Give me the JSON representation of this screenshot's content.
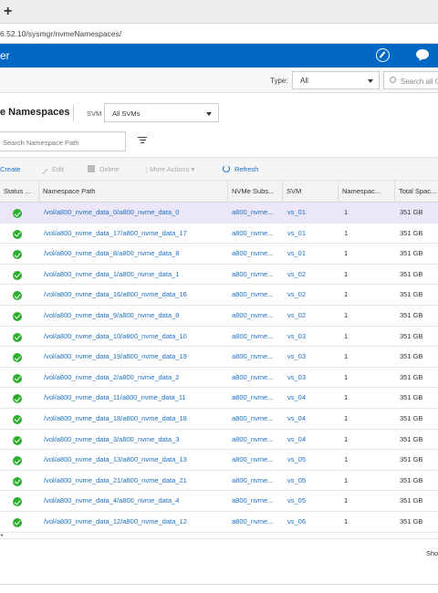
{
  "browser": {
    "tab_close": "×",
    "new_tab": "+",
    "address": "6.52.10/sysmgr/nvmeNamespaces/"
  },
  "app": {
    "title": "er"
  },
  "filter": {
    "type_label": "Type:",
    "type_value": "All",
    "search_placeholder": "Search all O"
  },
  "page": {
    "title": "e Namespaces",
    "svm_label": "SVM",
    "svm_value": "All SVMs",
    "search_placeholder": "Search Namespace Path"
  },
  "toolbar": {
    "create": "Create",
    "edit": "Edit",
    "delete": "Delete",
    "more_actions": "More Actions",
    "refresh": "Refresh"
  },
  "table": {
    "columns": [
      "Status ...",
      "Namespace Path",
      "NVMe Subs...",
      "SVM",
      "Namespac...",
      "Total Spac..."
    ],
    "rows": [
      {
        "path": "/vol/a800_nvme_data_0/a800_nvme_data_0",
        "subsystem": "a800_nvme...",
        "svm": "vs_01",
        "ns": "1",
        "total": "351 GB"
      },
      {
        "path": "/vol/a800_nvme_data_17/a800_nvme_data_17",
        "subsystem": "a800_nvme...",
        "svm": "vs_01",
        "ns": "1",
        "total": "351 GB"
      },
      {
        "path": "/vol/a800_nvme_data_8/a800_nvme_data_8",
        "subsystem": "a800_nvme...",
        "svm": "vs_01",
        "ns": "1",
        "total": "351 GB"
      },
      {
        "path": "/vol/a800_nvme_data_1/a800_nvme_data_1",
        "subsystem": "a800_nvme...",
        "svm": "vs_02",
        "ns": "1",
        "total": "351 GB"
      },
      {
        "path": "/vol/a800_nvme_data_16/a800_nvme_data_16",
        "subsystem": "a800_nvme...",
        "svm": "vs_02",
        "ns": "1",
        "total": "351 GB"
      },
      {
        "path": "/vol/a800_nvme_data_9/a800_nvme_data_9",
        "subsystem": "a800_nvme...",
        "svm": "vs_02",
        "ns": "1",
        "total": "351 GB"
      },
      {
        "path": "/vol/a800_nvme_data_10/a800_nvme_data_10",
        "subsystem": "a800_nvme...",
        "svm": "vs_03",
        "ns": "1",
        "total": "351 GB"
      },
      {
        "path": "/vol/a800_nvme_data_19/a800_nvme_data_19",
        "subsystem": "a800_nvme...",
        "svm": "vs_03",
        "ns": "1",
        "total": "351 GB"
      },
      {
        "path": "/vol/a800_nvme_data_2/a800_nvme_data_2",
        "subsystem": "a800_nvme...",
        "svm": "vs_03",
        "ns": "1",
        "total": "351 GB"
      },
      {
        "path": "/vol/a800_nvme_data_11/a800_nvme_data_11",
        "subsystem": "a800_nvme...",
        "svm": "vs_04",
        "ns": "1",
        "total": "351 GB"
      },
      {
        "path": "/vol/a800_nvme_data_18/a800_nvme_data_18",
        "subsystem": "a800_nvme...",
        "svm": "vs_04",
        "ns": "1",
        "total": "351 GB"
      },
      {
        "path": "/vol/a800_nvme_data_3/a800_nvme_data_3",
        "subsystem": "a800_nvme...",
        "svm": "vs_04",
        "ns": "1",
        "total": "351 GB"
      },
      {
        "path": "/vol/a800_nvme_data_13/a800_nvme_data_13",
        "subsystem": "a800_nvme...",
        "svm": "vs_05",
        "ns": "1",
        "total": "351 GB"
      },
      {
        "path": "/vol/a800_nvme_data_21/a800_nvme_data_21",
        "subsystem": "a800_nvme...",
        "svm": "vs_05",
        "ns": "1",
        "total": "351 GB"
      },
      {
        "path": "/vol/a800_nvme_data_4/a800_nvme_data_4",
        "subsystem": "a800_nvme...",
        "svm": "vs_05",
        "ns": "1",
        "total": "351 GB"
      },
      {
        "path": "/vol/a800_nvme_data_12/a800_nvme_data_12",
        "subsystem": "a800_nvme...",
        "svm": "vs_06",
        "ns": "1",
        "total": "351 GB"
      }
    ]
  },
  "footer": {
    "text": "Sho"
  }
}
